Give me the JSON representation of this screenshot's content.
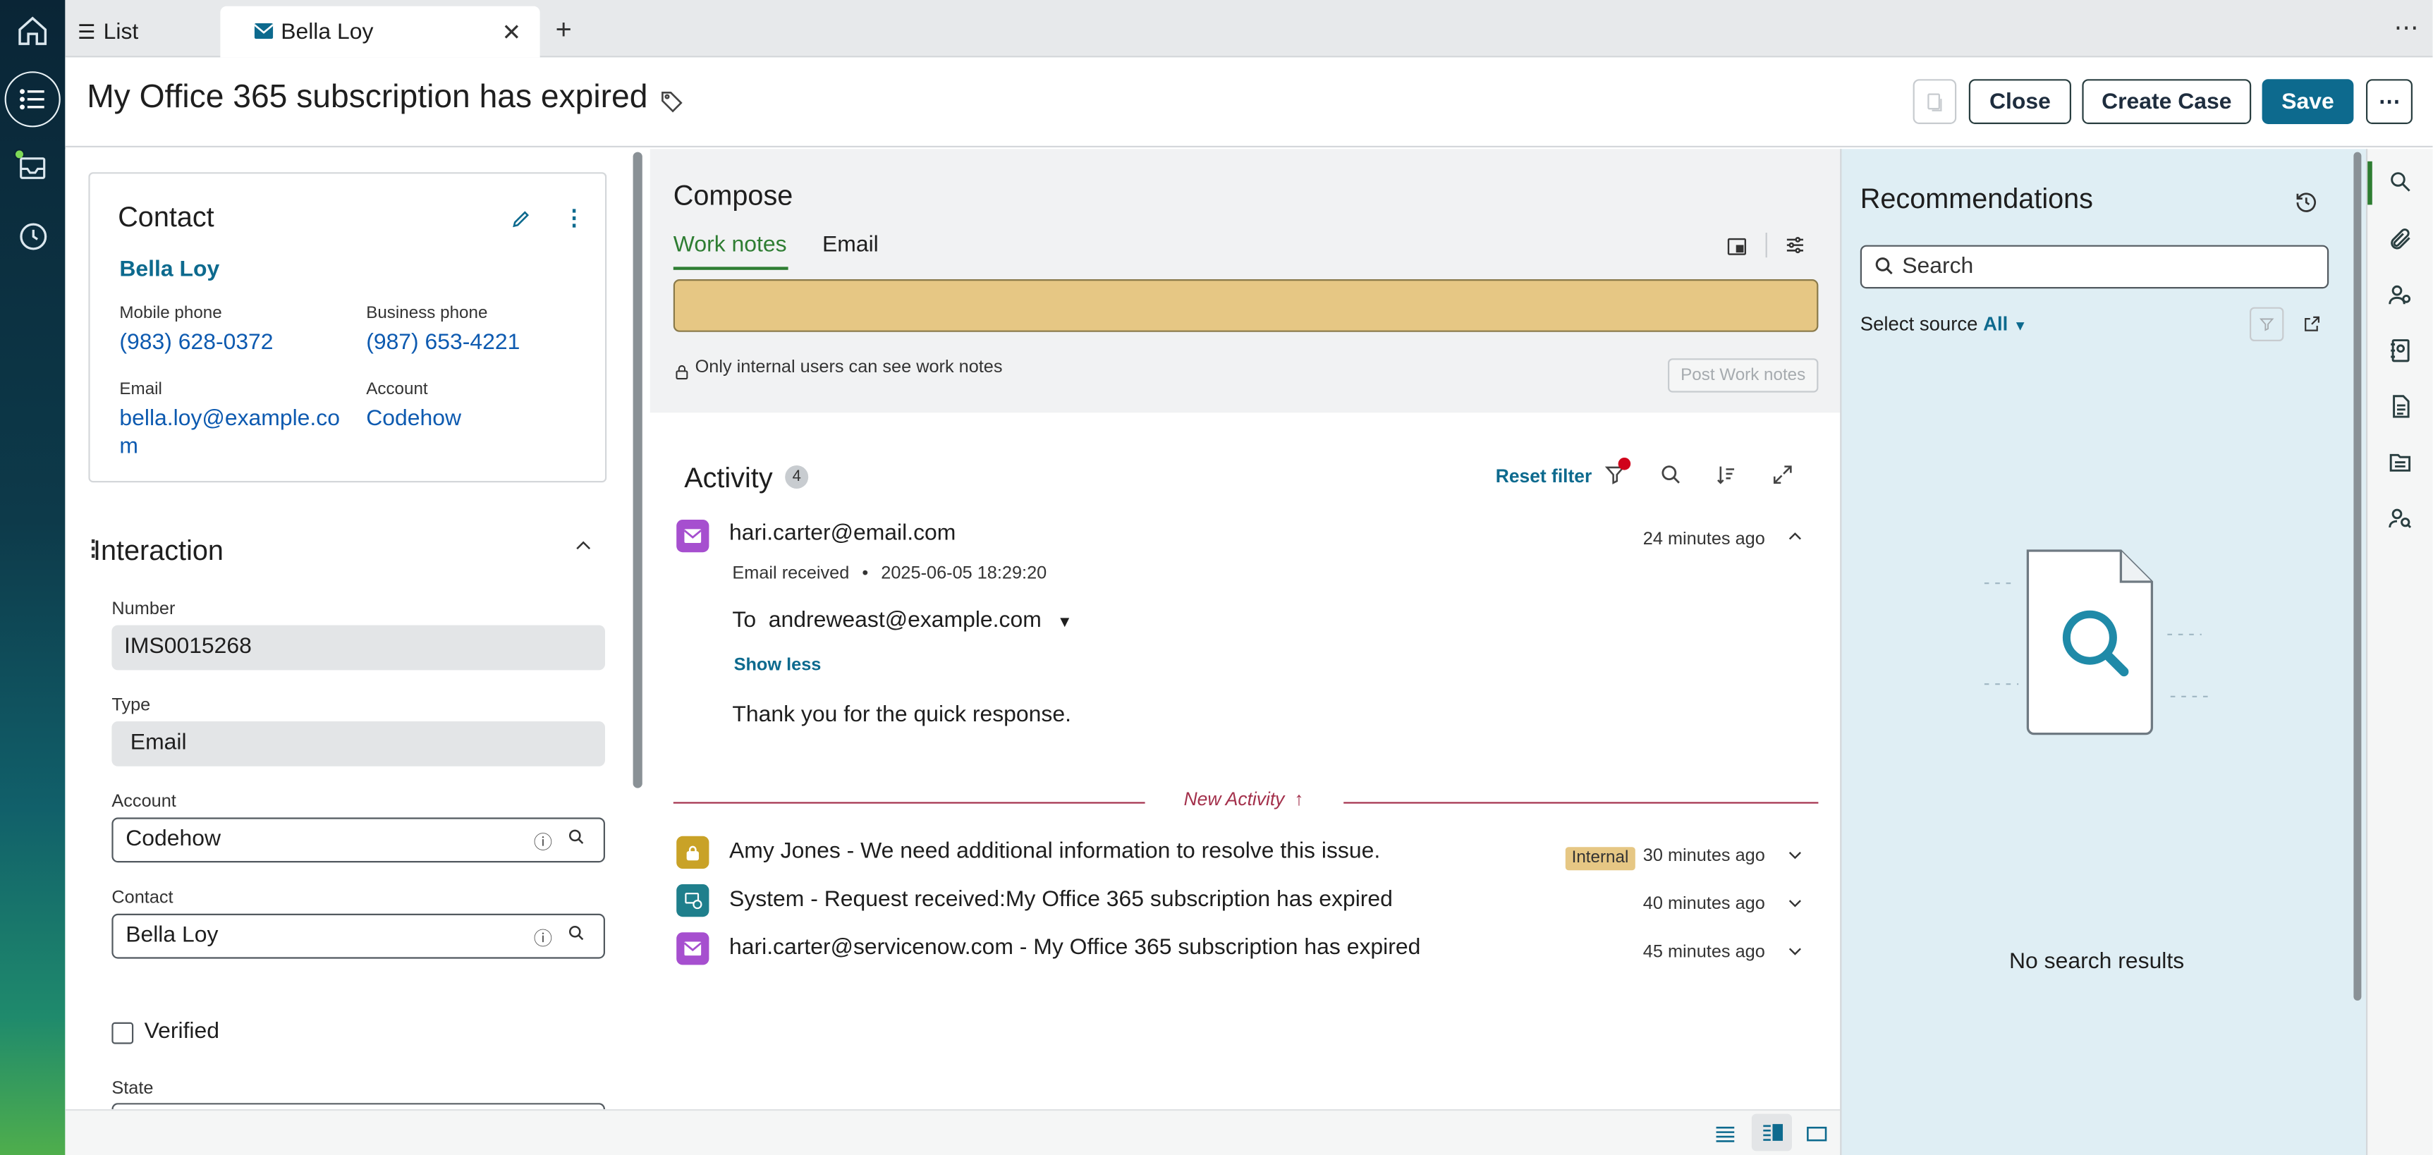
{
  "tabs": {
    "list_label": "List",
    "active_label": "Bella Loy"
  },
  "header": {
    "title": "My Office 365 subscription has expired",
    "close_label": "Close",
    "create_case_label": "Create Case",
    "save_label": "Save"
  },
  "contact": {
    "heading": "Contact",
    "name": "Bella Loy",
    "mobile_label": "Mobile phone",
    "mobile": "(983) 628-0372",
    "business_label": "Business phone",
    "business": "(987) 653-4221",
    "email_label": "Email",
    "email_line1": "bella.loy@example.co",
    "email_line2": "m",
    "account_label": "Account",
    "account": "Codehow"
  },
  "interaction": {
    "heading": "Interaction",
    "number_label": "Number",
    "number": "IMS0015268",
    "type_label": "Type",
    "type": "Email",
    "account_label": "Account",
    "account": "Codehow",
    "contact_label": "Contact",
    "contact": "Bella Loy",
    "verified_label": "Verified",
    "state_label": "State"
  },
  "compose": {
    "heading": "Compose",
    "tab_worknotes": "Work notes",
    "tab_email": "Email",
    "note": "Only internal users can see work notes",
    "post_label": "Post Work notes"
  },
  "activity": {
    "heading": "Activity",
    "count": "4",
    "reset_filter": "Reset filter",
    "expanded": {
      "from": "hari.carter@email.com",
      "time": "24 minutes ago",
      "meta": "Email received",
      "date": "2025-06-05 18:29:20",
      "to_label": "To",
      "to": "andreweast@example.com",
      "show_less": "Show less",
      "body": "Thank you for the quick response."
    },
    "new_activity": "New Activity",
    "entries": [
      {
        "title": "Amy Jones - We need additional information to resolve this issue.",
        "badge": "Internal",
        "time": "30 minutes ago"
      },
      {
        "title": "System - Request received:My Office 365 subscription has expired",
        "time": "40 minutes ago"
      },
      {
        "title": "hari.carter@servicenow.com - My Office 365 subscription has expired",
        "time": "45 minutes ago"
      }
    ]
  },
  "recommendations": {
    "heading": "Recommendations",
    "search_placeholder": "Search",
    "source_label": "Select source",
    "source_value": "All",
    "empty": "No search results"
  },
  "colors": {
    "brand": "#0d6a8e",
    "accent_green": "#2e7d32",
    "worknote_yellow": "#e6c784",
    "new_activity": "#a3304b"
  }
}
